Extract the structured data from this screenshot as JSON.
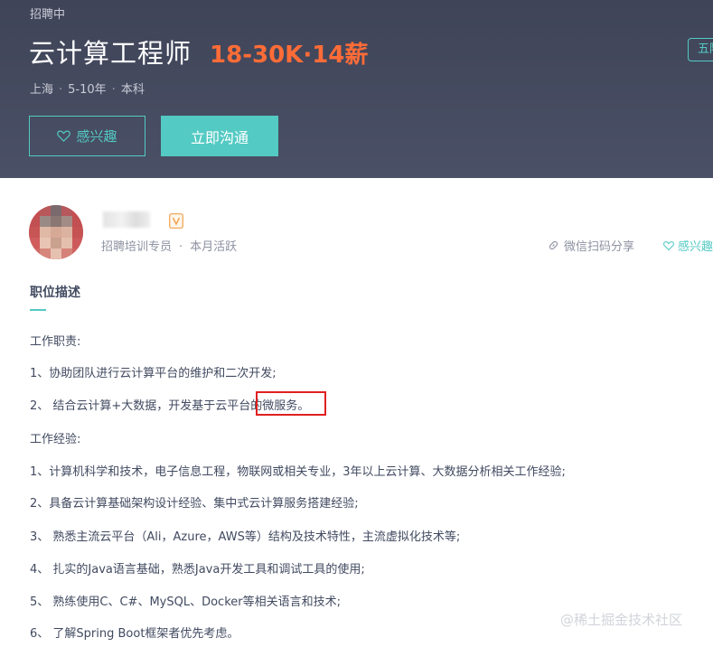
{
  "header": {
    "status": "招聘中",
    "job_title": "云计算工程师",
    "salary": "18-30K·14薪",
    "city": "上海",
    "experience": "5-10年",
    "education": "本科",
    "meta_separator": "·",
    "corner_tag": "五险",
    "interest_button": "感兴趣",
    "chat_button": "立即沟通"
  },
  "recruiter": {
    "role": "招聘培训专员",
    "activity": "本月活跃",
    "separator": "·",
    "share_label": "微信扫码分享",
    "interest_label": "感兴趣"
  },
  "description": {
    "section_title": "职位描述",
    "lines": [
      "工作职责:",
      "1、协助团队进行云计算平台的维护和二次开发;",
      "2、 结合云计算+大数据，开发基于云平台的微服务。",
      "工作经验:",
      "1、计算机科学和技术，电子信息工程，物联网或相关专业，3年以上云计算、大数据分析相关工作经验;",
      "2、具备云计算基础架构设计经验、集中式云计算服务搭建经验;",
      "3、 熟悉主流云平台（Ali，Azure，AWS等）结构及技术特性，主流虚拟化技术等;",
      "4、 扎实的Java语言基础，熟悉Java开发工具和调试工具的使用;",
      "5、 熟练使用C、C#、MySQL、Docker等相关语言和技术;",
      "6、 了解Spring Boot框架者优先考虑。"
    ]
  },
  "watermark": "@稀土掘金技术社区",
  "colors": {
    "header_bg": "#434a5e",
    "accent": "#53cac3",
    "salary": "#ff6c37",
    "highlight": "#e02020"
  }
}
